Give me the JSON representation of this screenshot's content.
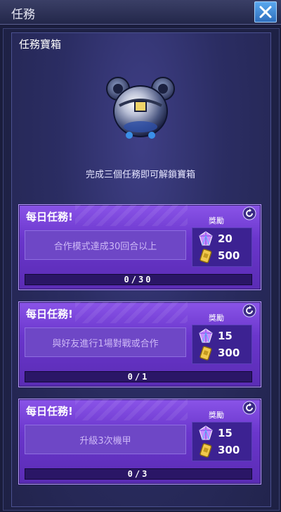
{
  "window": {
    "title": "任務"
  },
  "chest": {
    "title": "任務寶箱",
    "description": "完成三個任務即可解鎖寶箱"
  },
  "missions": [
    {
      "label": "每日任務!",
      "reward_label": "獎勵",
      "task": "合作模式達成30回合以上",
      "rewards": {
        "gem": "20",
        "coin": "500"
      },
      "progress_text": "0/30",
      "progress": 0
    },
    {
      "label": "每日任務!",
      "reward_label": "獎勵",
      "task": "與好友進行1場對戰或合作",
      "rewards": {
        "gem": "15",
        "coin": "300"
      },
      "progress_text": "0/1",
      "progress": 0
    },
    {
      "label": "每日任務!",
      "reward_label": "獎勵",
      "task": "升級3次機甲",
      "rewards": {
        "gem": "15",
        "coin": "300"
      },
      "progress_text": "0/3",
      "progress": 0
    }
  ],
  "colors": {
    "accent_purple": "#6a36cc",
    "gem": "#c98cff",
    "coin": "#f2c94c",
    "close_button": "#3f8fdc"
  },
  "icons": [
    "close-icon",
    "chest-icon",
    "refresh-icon",
    "gem-icon",
    "coin-icon"
  ]
}
